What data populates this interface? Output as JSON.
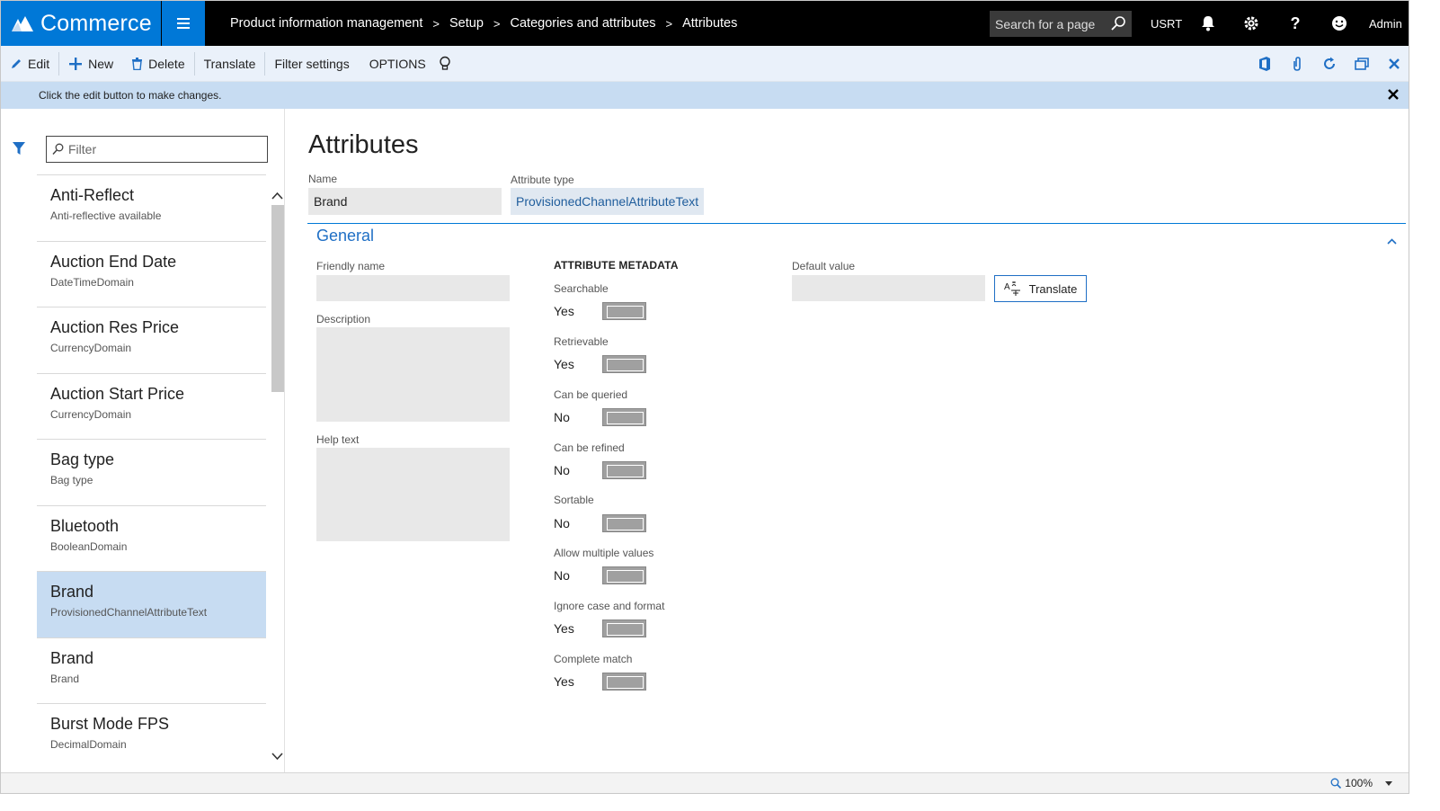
{
  "app": {
    "name": "Commerce"
  },
  "breadcrumbs": [
    "Product information management",
    "Setup",
    "Categories and attributes",
    "Attributes"
  ],
  "search": {
    "placeholder": "Search for a page"
  },
  "company": "USRT",
  "user": "Admin",
  "toolbar": {
    "edit": "Edit",
    "new": "New",
    "delete": "Delete",
    "translate": "Translate",
    "filter_settings": "Filter settings",
    "options": "OPTIONS"
  },
  "message": "Click the edit button to make changes.",
  "filter": {
    "placeholder": "Filter"
  },
  "list": [
    {
      "title": "Anti-Reflect",
      "subtitle": "Anti-reflective available"
    },
    {
      "title": "Auction End Date",
      "subtitle": "DateTimeDomain"
    },
    {
      "title": "Auction Res Price",
      "subtitle": "CurrencyDomain"
    },
    {
      "title": "Auction Start Price",
      "subtitle": "CurrencyDomain"
    },
    {
      "title": "Bag type",
      "subtitle": "Bag type"
    },
    {
      "title": "Bluetooth",
      "subtitle": "BooleanDomain"
    },
    {
      "title": "Brand",
      "subtitle": "ProvisionedChannelAttributeText",
      "selected": true
    },
    {
      "title": "Brand",
      "subtitle": "Brand"
    },
    {
      "title": "Burst Mode FPS",
      "subtitle": "DecimalDomain"
    }
  ],
  "detail": {
    "title": "Attributes",
    "name_label": "Name",
    "name_value": "Brand",
    "type_label": "Attribute type",
    "type_value": "ProvisionedChannelAttributeText",
    "section": "General",
    "friendly_name_label": "Friendly name",
    "description_label": "Description",
    "help_text_label": "Help text",
    "metadata_heading": "ATTRIBUTE METADATA",
    "metadata": [
      {
        "label": "Searchable",
        "value": "Yes"
      },
      {
        "label": "Retrievable",
        "value": "Yes"
      },
      {
        "label": "Can be queried",
        "value": "No"
      },
      {
        "label": "Can be refined",
        "value": "No"
      },
      {
        "label": "Sortable",
        "value": "No"
      },
      {
        "label": "Allow multiple values",
        "value": "No"
      },
      {
        "label": "Ignore case and format",
        "value": "Yes"
      },
      {
        "label": "Complete match",
        "value": "Yes"
      }
    ],
    "default_value_label": "Default value",
    "translate_button": "Translate"
  },
  "status": {
    "zoom": "100%"
  },
  "colors": {
    "accent": "#0078d7",
    "selection": "#c7dcf2",
    "actionbar": "#eaf1fa"
  }
}
